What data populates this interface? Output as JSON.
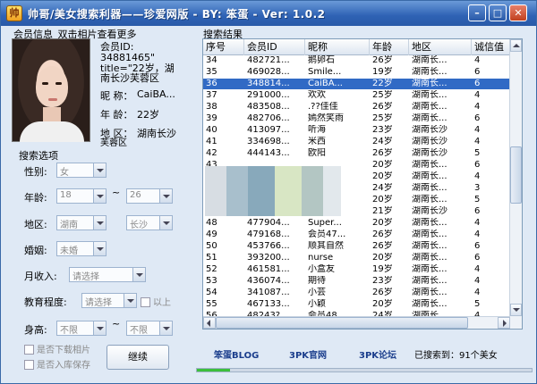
{
  "window": {
    "title": "帅哥/美女搜索利器——珍爱网版 - BY: 笨蛋 - Ver: 1.0.2",
    "icon_glyph": "帅",
    "min_glyph": "–",
    "max_glyph": "□",
    "close_glyph": "✕"
  },
  "member_info": {
    "section_title": "会员信息_双击相片查看更多",
    "id_label": "会员ID:",
    "id_value": "34881465\"",
    "title_line1": "title=\"22岁，湖",
    "title_line2": "南长沙芙蓉区",
    "nick_label": "昵  称：",
    "nick_value": "CaiBA...",
    "age_label": "年  龄：",
    "age_value": "22岁",
    "region_label": "地  区：",
    "region_value": "湖南长沙",
    "region_extra": "芙蓉区"
  },
  "search_options": {
    "section_title": "搜索选项",
    "gender_label": "性别:",
    "gender_value": "女",
    "age_label": "年龄:",
    "age_from": "18",
    "age_to": "26",
    "tilde": "~",
    "region_label": "地区:",
    "province": "湖南",
    "city": "长沙",
    "marriage_label": "婚姻:",
    "marriage_value": "未婚",
    "income_label": "月收入:",
    "income_value": "请选择",
    "edu_label": "教育程度:",
    "edu_value": "请选择",
    "edu_above": "以上",
    "height_label": "身高:",
    "height_from": "不限",
    "height_to": "不限",
    "no_photo": "是否下载相片",
    "save_db": "是否入库保存",
    "go_button": "继续"
  },
  "results": {
    "section_title": "搜索结果",
    "columns": [
      "序号",
      "会员ID",
      "昵称",
      "年龄",
      "地区",
      "诚信值"
    ],
    "selected_index": 2,
    "rows": [
      [
        "34",
        "482721...",
        "鹅卵石",
        "26岁",
        "湖南长...",
        "4"
      ],
      [
        "35",
        "469028...",
        "Smile...",
        "19岁",
        "湖南长...",
        "6"
      ],
      [
        "36",
        "348814...",
        "CaiBA...",
        "22岁",
        "湖南长...",
        "6"
      ],
      [
        "37",
        "291000...",
        "欢欢",
        "25岁",
        "湖南长...",
        "4"
      ],
      [
        "38",
        "483508...",
        ".??佳佳",
        "26岁",
        "湖南长...",
        "4"
      ],
      [
        "39",
        "482706...",
        "嫣然笑雨",
        "25岁",
        "湖南长...",
        "6"
      ],
      [
        "40",
        "413097...",
        "听海",
        "23岁",
        "湖南长沙",
        "4"
      ],
      [
        "41",
        "334698...",
        "米西",
        "24岁",
        "湖南长沙",
        "4"
      ],
      [
        "42",
        "444143...",
        "欧阳",
        "26岁",
        "湖南长沙",
        "5"
      ],
      [
        "43",
        "",
        "",
        "20岁",
        "湖南长...",
        "6"
      ],
      [
        "44",
        "",
        "",
        "20岁",
        "湖南长...",
        "4"
      ],
      [
        "45",
        "",
        "",
        "24岁",
        "湖南长...",
        "3"
      ],
      [
        "46",
        "",
        "",
        "20岁",
        "湖南长...",
        "5"
      ],
      [
        "47",
        "",
        "",
        "21岁",
        "湖南长沙",
        "6"
      ],
      [
        "48",
        "477904...",
        "Super...",
        "20岁",
        "湖南长...",
        "4"
      ],
      [
        "49",
        "479168...",
        "会员47...",
        "26岁",
        "湖南长...",
        "4"
      ],
      [
        "50",
        "453766...",
        "顺其自然",
        "26岁",
        "湖南长...",
        "6"
      ],
      [
        "51",
        "393200...",
        "nurse",
        "20岁",
        "湖南长...",
        "6"
      ],
      [
        "52",
        "461581...",
        "小盒友",
        "19岁",
        "湖南长...",
        "4"
      ],
      [
        "53",
        "436074...",
        "期待",
        "23岁",
        "湖南长...",
        "4"
      ],
      [
        "54",
        "341087...",
        "小芸",
        "26岁",
        "湖南长...",
        "4"
      ],
      [
        "55",
        "467133...",
        "小颖",
        "20岁",
        "湖南长...",
        "5"
      ],
      [
        "56",
        "48243?...",
        "会员48",
        "24岁",
        "湖南长...",
        "4"
      ]
    ]
  },
  "footer": {
    "link1": "笨蛋BLOG",
    "link2": "3PK官网",
    "link3": "3PK论坛",
    "status": "已搜索到：91个美女",
    "progress_fraction": 0.1
  },
  "colors": {
    "selection": "#316ac5",
    "progress": "#3cbf3c",
    "link": "#1a3d8c"
  }
}
